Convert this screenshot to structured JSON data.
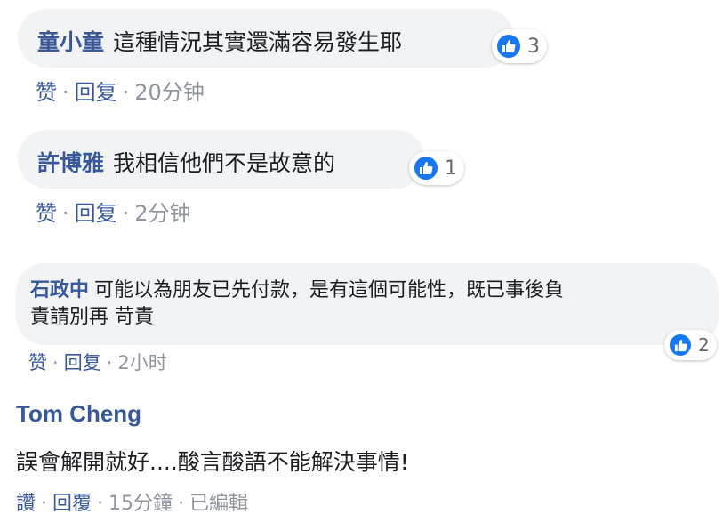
{
  "comments": [
    {
      "author": "童小童",
      "text": "這種情況其實還滿容易發生耶",
      "like_count": "3",
      "actions": {
        "like": "赞",
        "reply": "回复",
        "time": "20分钟"
      }
    },
    {
      "author": "許博雅",
      "text": "我相信他們不是故意的",
      "like_count": "1",
      "actions": {
        "like": "赞",
        "reply": "回复",
        "time": "2分钟"
      }
    },
    {
      "author": "石政中",
      "text_line1": "可能以為朋友已先付款，是有這個可能性，既已事後負",
      "text_line2": "責請別再 苛責",
      "like_count": "2",
      "actions": {
        "like": "赞",
        "reply": "回复",
        "time": "2小时"
      }
    },
    {
      "author": "Tom Cheng",
      "text": "誤會解開就好....酸言酸語不能解決事情!",
      "actions": {
        "like": "讚",
        "reply": "回覆",
        "time": "15分鐘",
        "edited": "已編輯"
      }
    }
  ],
  "colors": {
    "author": "#385898",
    "bubble": "#f2f3f5",
    "like_blue": "#1877f2"
  }
}
